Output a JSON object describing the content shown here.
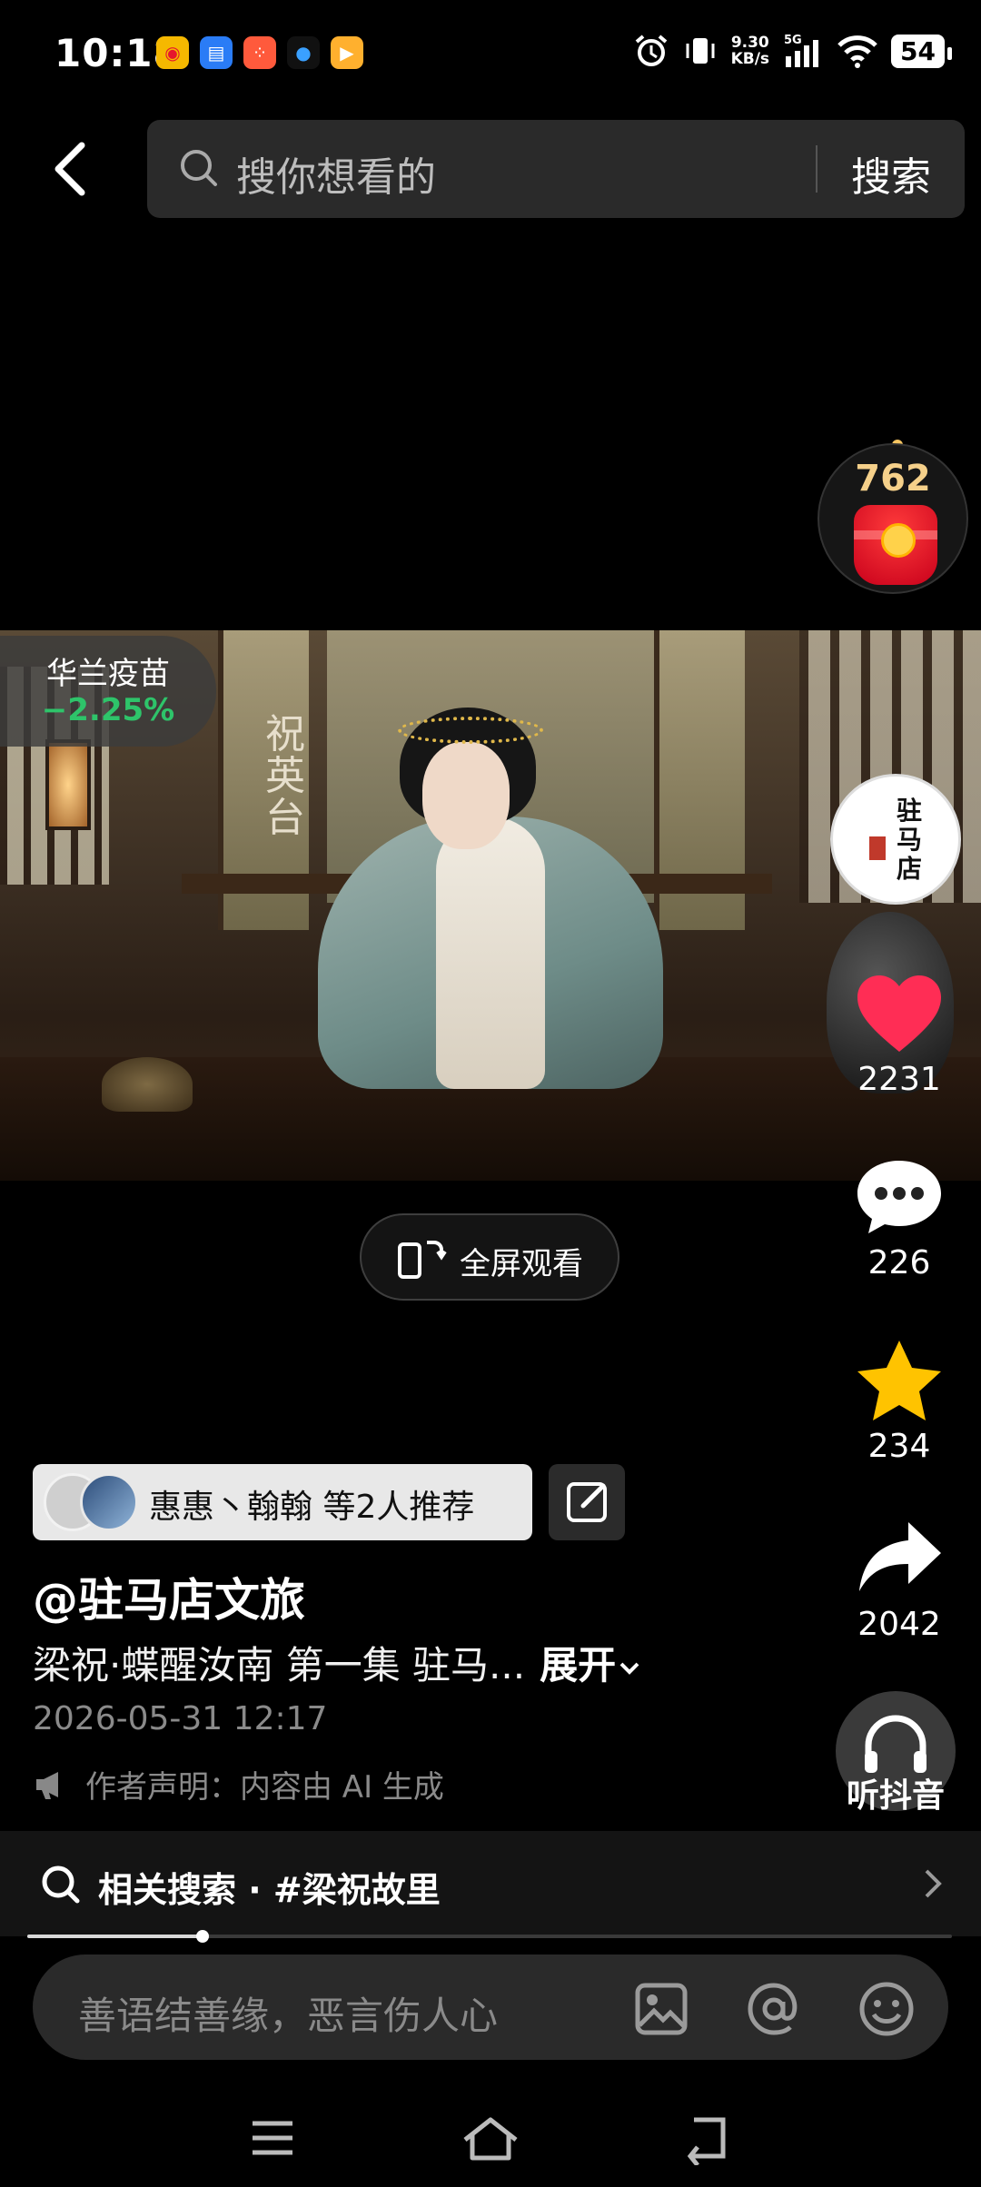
{
  "status_bar": {
    "time": "10:18",
    "net_speed_value": "9.30",
    "net_speed_unit": "KB/s",
    "network": "5G",
    "battery": "54"
  },
  "search": {
    "placeholder": "搜你想看的",
    "button_label": "搜索"
  },
  "red_packet": {
    "count": "762"
  },
  "video": {
    "caption_overlay": "祝英台",
    "stock": {
      "name": "华兰疫苗",
      "change": "−2.25%"
    }
  },
  "actions": {
    "author_avatar_text": "驻马店",
    "likes": "2231",
    "comments": "226",
    "favorites": "234",
    "shares": "2042",
    "listen_label": "听抖音"
  },
  "fullscreen": {
    "label": "全屏观看"
  },
  "recommend": {
    "text": "惠惠丶翰翰 等2人推荐"
  },
  "post": {
    "author": "@驻马店文旅",
    "description": "梁祝·蝶醒汝南 第一集 驻马...",
    "expand_label": "展开",
    "datetime": "2026-05-31 12:17",
    "ai_note": "作者声明：内容由 AI 生成"
  },
  "related": {
    "text": "相关搜索 · #梁祝故里"
  },
  "progress": {
    "fraction": 0.19
  },
  "comment_bar": {
    "placeholder": "善语结善缘，恶言伤人心"
  },
  "colors": {
    "like": "#ff2d55",
    "favorite": "#ffc300",
    "stock_down": "#2ec46a",
    "red_packet_count": "#f5d08a"
  }
}
